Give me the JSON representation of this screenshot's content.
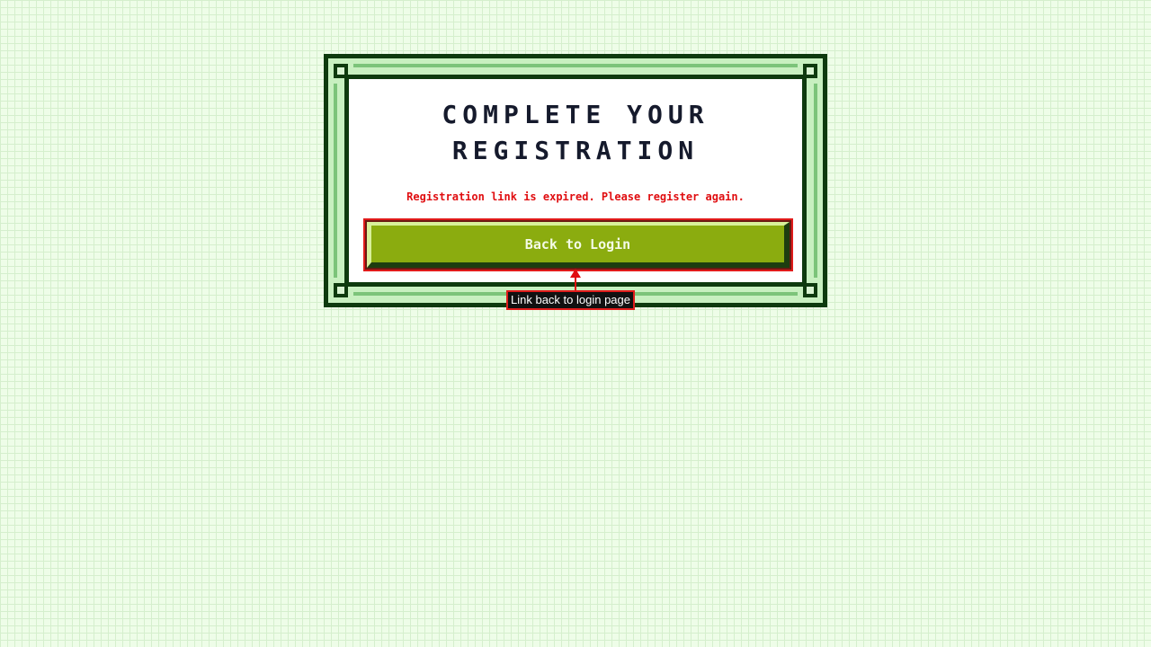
{
  "card": {
    "title_lines": [
      "Complete your",
      "registration"
    ],
    "error_message": "Registration link is expired. Please register again.",
    "back_button_label": "Back to Login"
  },
  "annotation": {
    "label": "Link back to login page"
  },
  "colors": {
    "page_background": "#eefde8",
    "frame_dark": "#0e3a0e",
    "frame_stripe": "#7cc47a",
    "button_fill": "#8bac0f",
    "error_text": "#e00d10",
    "title_text": "#151a2c"
  }
}
